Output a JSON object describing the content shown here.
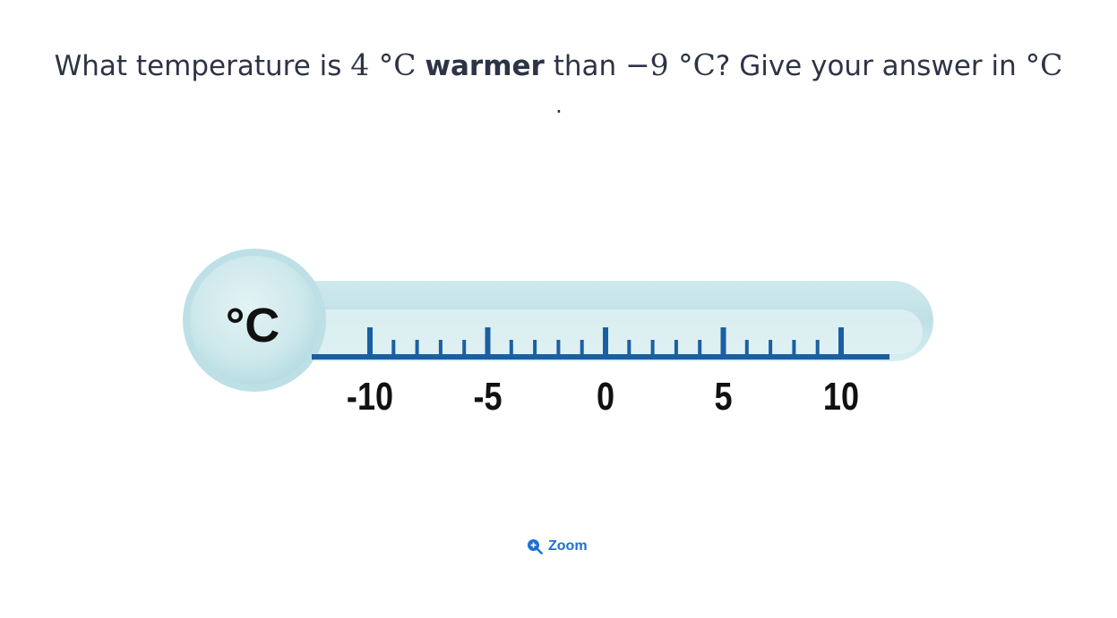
{
  "question": {
    "prefix": "What temperature is ",
    "value1": "4 °C",
    "bold": "warmer",
    "middle": " than ",
    "value2": "−9 °C",
    "suffix": "? Give your answer in ",
    "unit": "°C",
    "period": "."
  },
  "thermometer": {
    "unit_label": "°C",
    "scale_min": -12,
    "scale_max": 12,
    "tick_labels": [
      "-10",
      "-5",
      "0",
      "5",
      "10"
    ],
    "tick_values": [
      -10,
      -5,
      0,
      5,
      10
    ],
    "minor_tick_step": 1,
    "colors": {
      "bulb": "#d4ecef",
      "tube": "#c3e3e8",
      "scale": "#1b5fa3",
      "label": "#111111"
    }
  },
  "zoom": {
    "label": "Zoom",
    "icon": "zoom-in-icon",
    "color": "#1f6fd1"
  }
}
